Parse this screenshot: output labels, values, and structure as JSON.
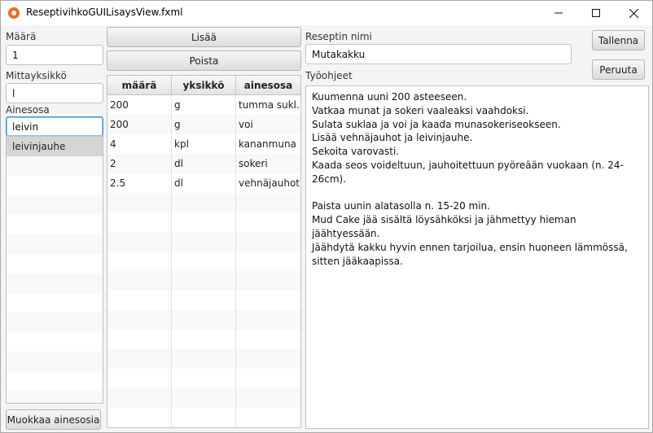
{
  "window": {
    "title": "ReseptivihkoGUILisaysView.fxml"
  },
  "left_panel": {
    "amount_label": "Määrä",
    "amount_value": "1",
    "unit_label": "Mittayksikkö",
    "unit_value": "l",
    "ingredient_label": "Ainesosa",
    "ingredient_value": "leivin",
    "suggestions": [
      "leivinjauhe",
      "",
      "",
      "",
      "",
      "",
      "",
      "",
      "",
      "",
      "",
      "",
      "",
      ""
    ],
    "edit_button_label": "Muokkaa ainesosia"
  },
  "middle_panel": {
    "add_button_label": "Lisää",
    "remove_button_label": "Poista",
    "table": {
      "columns": [
        "määrä",
        "yksikkö",
        "ainesosa"
      ],
      "rows": [
        [
          "200",
          "g",
          "tumma sukl..."
        ],
        [
          "200",
          "g",
          "voi"
        ],
        [
          "4",
          "kpl",
          "kananmuna"
        ],
        [
          "2",
          "dl",
          "sokeri"
        ],
        [
          "2.5",
          "dl",
          "vehnäjauhot"
        ],
        [
          "",
          "",
          ""
        ],
        [
          "",
          "",
          ""
        ],
        [
          "",
          "",
          ""
        ],
        [
          "",
          "",
          ""
        ],
        [
          "",
          "",
          ""
        ],
        [
          "",
          "",
          ""
        ],
        [
          "",
          "",
          ""
        ],
        [
          "",
          "",
          ""
        ],
        [
          "",
          "",
          ""
        ],
        [
          "",
          "",
          ""
        ],
        [
          "",
          "",
          ""
        ],
        [
          "",
          "",
          ""
        ]
      ]
    }
  },
  "right_panel": {
    "recipe_name_label": "Reseptin nimi",
    "recipe_name_value": "Mutakakku",
    "instructions_label": "Työohjeet",
    "instructions_text": "Kuumenna uuni 200 asteeseen.\nVatkaa munat ja sokeri vaaleaksi vaahdoksi.\nSulata suklaa ja voi ja kaada munasokeriseokseen.\nLisää vehnäjauhot ja leivinjauhe.\nSekoita varovasti.\nKaada seos voideltuun, jauhoitettuun pyöreään vuokaan (n. 24-26cm).\n\nPaista uunin alatasolla n. 15-20 min.\nMud Cake jää sisältä löysähköksi ja jähmettyy hieman jäähtyessään.\nJäähdytä kakku hyvin ennen tarjoilua, ensin huoneen lämmössä, sitten jääkaapissa.",
    "save_button_label": "Tallenna",
    "cancel_button_label": "Peruuta"
  }
}
